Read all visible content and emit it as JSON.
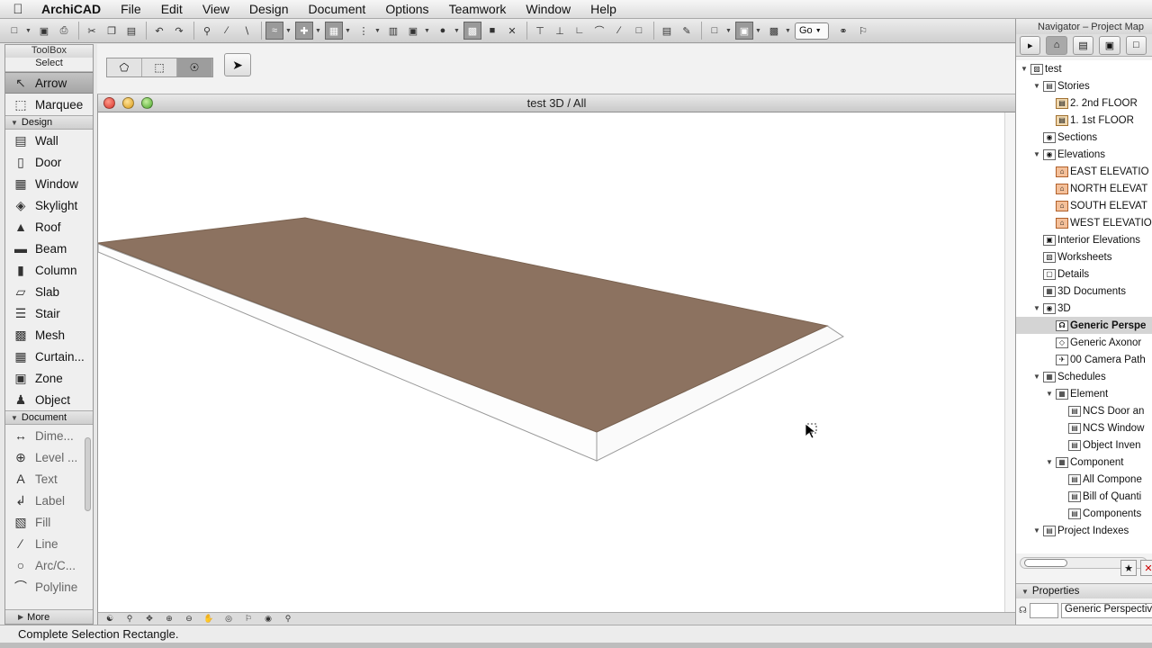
{
  "menubar": {
    "app_name": "ArchiCAD",
    "items": [
      "File",
      "Edit",
      "View",
      "Design",
      "Document",
      "Options",
      "Teamwork",
      "Window",
      "Help"
    ]
  },
  "toolbar": {
    "go_label": "Go"
  },
  "toolbox": {
    "title": "ToolBox",
    "select_label": "Select",
    "select_tools": [
      {
        "label": "Arrow",
        "icon": "arrow-icon"
      },
      {
        "label": "Marquee",
        "icon": "marquee-icon"
      }
    ],
    "design_header": "Design",
    "design_tools": [
      {
        "label": "Wall",
        "icon": "wall-icon"
      },
      {
        "label": "Door",
        "icon": "door-icon"
      },
      {
        "label": "Window",
        "icon": "window-icon"
      },
      {
        "label": "Skylight",
        "icon": "skylight-icon"
      },
      {
        "label": "Roof",
        "icon": "roof-icon"
      },
      {
        "label": "Beam",
        "icon": "beam-icon"
      },
      {
        "label": "Column",
        "icon": "column-icon"
      },
      {
        "label": "Slab",
        "icon": "slab-icon"
      },
      {
        "label": "Stair",
        "icon": "stair-icon"
      },
      {
        "label": "Mesh",
        "icon": "mesh-icon"
      },
      {
        "label": "Curtain...",
        "icon": "curtain-wall-icon"
      },
      {
        "label": "Zone",
        "icon": "zone-icon"
      },
      {
        "label": "Object",
        "icon": "object-icon"
      }
    ],
    "document_header": "Document",
    "document_tools": [
      {
        "label": "Dime...",
        "icon": "dimension-icon"
      },
      {
        "label": "Level ...",
        "icon": "level-dimension-icon"
      },
      {
        "label": "Text",
        "icon": "text-icon"
      },
      {
        "label": "Label",
        "icon": "label-icon"
      },
      {
        "label": "Fill",
        "icon": "fill-icon"
      },
      {
        "label": "Line",
        "icon": "line-icon"
      },
      {
        "label": "Arc/C...",
        "icon": "arc-icon"
      },
      {
        "label": "Polyline",
        "icon": "polyline-icon"
      }
    ],
    "more_label": "More"
  },
  "window3d": {
    "title": "test 3D / All"
  },
  "navigator": {
    "title": "Navigator – Project Map",
    "tree": [
      {
        "label": "test",
        "level": 0,
        "expand": "▼",
        "icon": "folder-icon"
      },
      {
        "label": "Stories",
        "level": 1,
        "expand": "▼",
        "icon": "stories-icon"
      },
      {
        "label": "2. 2nd FLOOR",
        "level": 2,
        "expand": "",
        "icon": "story-icon"
      },
      {
        "label": "1. 1st FLOOR",
        "level": 2,
        "expand": "",
        "icon": "story-icon"
      },
      {
        "label": "Sections",
        "level": 1,
        "expand": "",
        "icon": "section-icon"
      },
      {
        "label": "Elevations",
        "level": 1,
        "expand": "▼",
        "icon": "elevation-icon"
      },
      {
        "label": "EAST ELEVATIO",
        "level": 2,
        "expand": "",
        "icon": "elevation-view-icon"
      },
      {
        "label": "NORTH ELEVAT",
        "level": 2,
        "expand": "",
        "icon": "elevation-view-icon"
      },
      {
        "label": "SOUTH ELEVAT",
        "level": 2,
        "expand": "",
        "icon": "elevation-view-icon"
      },
      {
        "label": "WEST ELEVATIO",
        "level": 2,
        "expand": "",
        "icon": "elevation-view-icon"
      },
      {
        "label": "Interior Elevations",
        "level": 1,
        "expand": "",
        "icon": "interior-elevation-icon"
      },
      {
        "label": "Worksheets",
        "level": 1,
        "expand": "",
        "icon": "worksheet-icon"
      },
      {
        "label": "Details",
        "level": 1,
        "expand": "",
        "icon": "detail-icon"
      },
      {
        "label": "3D Documents",
        "level": 1,
        "expand": "",
        "icon": "3d-document-icon"
      },
      {
        "label": "3D",
        "level": 1,
        "expand": "▼",
        "icon": "3d-icon"
      },
      {
        "label": "Generic Perspe",
        "level": 2,
        "expand": "",
        "icon": "camera-icon",
        "selected": true
      },
      {
        "label": "Generic Axonor",
        "level": 2,
        "expand": "",
        "icon": "axonometry-icon"
      },
      {
        "label": "00 Camera Path",
        "level": 2,
        "expand": "",
        "icon": "camera-path-icon"
      },
      {
        "label": "Schedules",
        "level": 1,
        "expand": "▼",
        "icon": "schedule-icon"
      },
      {
        "label": "Element",
        "level": 2,
        "expand": "▼",
        "icon": "schedule-icon"
      },
      {
        "label": "NCS Door an",
        "level": 3,
        "expand": "",
        "icon": "table-icon"
      },
      {
        "label": "NCS Window",
        "level": 3,
        "expand": "",
        "icon": "table-icon"
      },
      {
        "label": "Object Inven",
        "level": 3,
        "expand": "",
        "icon": "table-icon"
      },
      {
        "label": "Component",
        "level": 2,
        "expand": "▼",
        "icon": "schedule-icon"
      },
      {
        "label": "All Compone",
        "level": 3,
        "expand": "",
        "icon": "table-icon"
      },
      {
        "label": "Bill of Quanti",
        "level": 3,
        "expand": "",
        "icon": "table-icon"
      },
      {
        "label": "Components",
        "level": 3,
        "expand": "",
        "icon": "table-icon"
      },
      {
        "label": "Project Indexes",
        "level": 1,
        "expand": "▼",
        "icon": "index-icon"
      }
    ],
    "properties_label": "Properties",
    "properties_value": "Generic Perspective"
  },
  "statusbar": {
    "text": "Complete Selection Rectangle."
  },
  "colors": {
    "slab_top": "#8c7260",
    "slab_edge": "#ffffff"
  }
}
